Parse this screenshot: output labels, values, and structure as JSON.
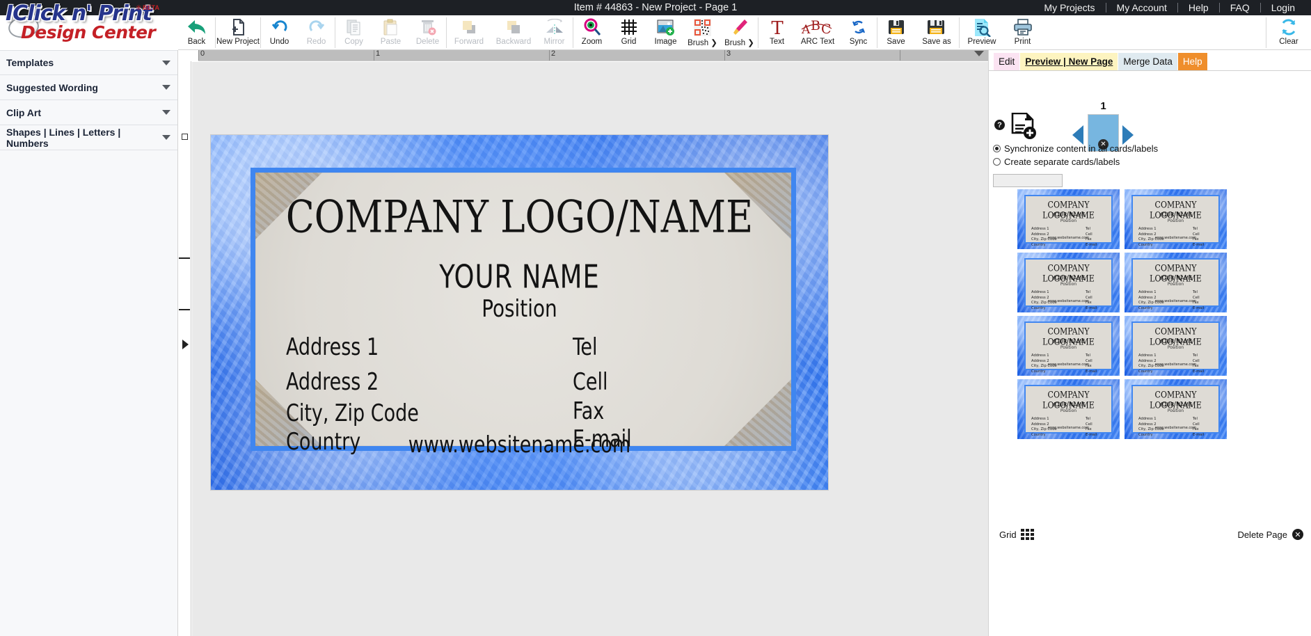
{
  "topbar": {
    "title": "Item # 44863 - New Project - Page 1",
    "links": [
      "My Projects",
      "My Account",
      "Help",
      "FAQ",
      "Login"
    ]
  },
  "logo": {
    "brand": "IClick n' Print",
    "badge": "® BETA",
    "subtitle": "Design Center"
  },
  "toolbar": {
    "items": [
      {
        "label": "Back",
        "icon": "back-arrow-icon",
        "disabled": false
      },
      {
        "label": "New Project",
        "icon": "new-document-icon",
        "disabled": false
      },
      {
        "label": "Undo",
        "icon": "undo-icon",
        "disabled": false
      },
      {
        "label": "Redo",
        "icon": "redo-icon",
        "disabled": true
      },
      {
        "label": "Copy",
        "icon": "copy-icon",
        "disabled": true
      },
      {
        "label": "Paste",
        "icon": "paste-icon",
        "disabled": true
      },
      {
        "label": "Delete",
        "icon": "trash-icon",
        "disabled": true
      },
      {
        "label": "Forward",
        "icon": "bring-forward-icon",
        "disabled": true
      },
      {
        "label": "Backward",
        "icon": "send-backward-icon",
        "disabled": true
      },
      {
        "label": "Mirror",
        "icon": "mirror-icon",
        "disabled": true
      },
      {
        "label": "Zoom",
        "icon": "magnifier-eye-icon",
        "disabled": false
      },
      {
        "label": "Grid",
        "icon": "grid-icon",
        "disabled": false
      },
      {
        "label": "Image",
        "icon": "add-image-icon",
        "disabled": false
      },
      {
        "label": "QR",
        "icon": "qr-code-icon",
        "disabled": false
      },
      {
        "label": "Brush ❯",
        "icon": "paintbrush-icon",
        "disabled": false
      },
      {
        "label": "Text",
        "icon": "text-t-icon",
        "disabled": false
      },
      {
        "label": "ARC Text",
        "icon": "arc-text-icon",
        "disabled": false
      },
      {
        "label": "Sync",
        "icon": "sync-icon",
        "disabled": false
      },
      {
        "label": "Save",
        "icon": "save-floppy-icon",
        "disabled": false
      },
      {
        "label": "Save as",
        "icon": "save-as-floppy-icon",
        "disabled": false
      },
      {
        "label": "Preview",
        "icon": "preview-document-icon",
        "disabled": false
      },
      {
        "label": "Print",
        "icon": "printer-icon",
        "disabled": false
      }
    ],
    "clear": {
      "label": "Clear",
      "icon": "refresh-circular-icon"
    }
  },
  "sidebar": {
    "items": [
      {
        "label": "Templates"
      },
      {
        "label": "Suggested Wording"
      },
      {
        "label": "Clip Art"
      },
      {
        "label": "Shapes | Lines | Letters | Numbers"
      }
    ]
  },
  "canvas": {
    "ruler_numbers": [
      "0",
      "1",
      "2",
      "3"
    ],
    "card": {
      "company": "COMPANY LOGO/NAME",
      "name": "YOUR NAME",
      "position": "Position",
      "left_lines": [
        "Address 1",
        "Address 2",
        "City, Zip Code",
        "Country"
      ],
      "right_lines": [
        "Tel",
        "Cell",
        "Fax",
        "E-mail"
      ],
      "website": "www.websitename.com"
    }
  },
  "rightpanel": {
    "tabs": [
      {
        "label": "Edit",
        "style": "edit"
      },
      {
        "label": "Preview | New Page",
        "style": "preview"
      },
      {
        "label": "Merge Data",
        "style": "merge"
      },
      {
        "label": "Help",
        "style": "help"
      }
    ],
    "page_number": "1",
    "help_glyph": "?",
    "close_glyph": "✕",
    "radios": [
      {
        "label": "Synchronize content in all cards/labels",
        "selected": true
      },
      {
        "label": "Create separate cards/labels",
        "selected": false
      }
    ],
    "thumb_input_value": "",
    "thumbnail_count": 8,
    "thumbnail": {
      "company": "COMPANY LOGO/NAME",
      "name": "YOUR NAME",
      "position": "Position",
      "left_lines": [
        "Address 1",
        "Address 2",
        "City, Zip Code",
        "Country"
      ],
      "right_lines": [
        "Tel",
        "Cell",
        "Fax",
        "E-mail"
      ],
      "website": "www.websitename.com"
    },
    "grid_label": "Grid",
    "delete_page_label": "Delete Page"
  },
  "colors": {
    "topbar_bg": "#1d2025",
    "accent_blue": "#2f7ef5",
    "help_orange": "#ef8e2c",
    "logo_blue": "#26348c",
    "logo_red": "#c42026"
  }
}
